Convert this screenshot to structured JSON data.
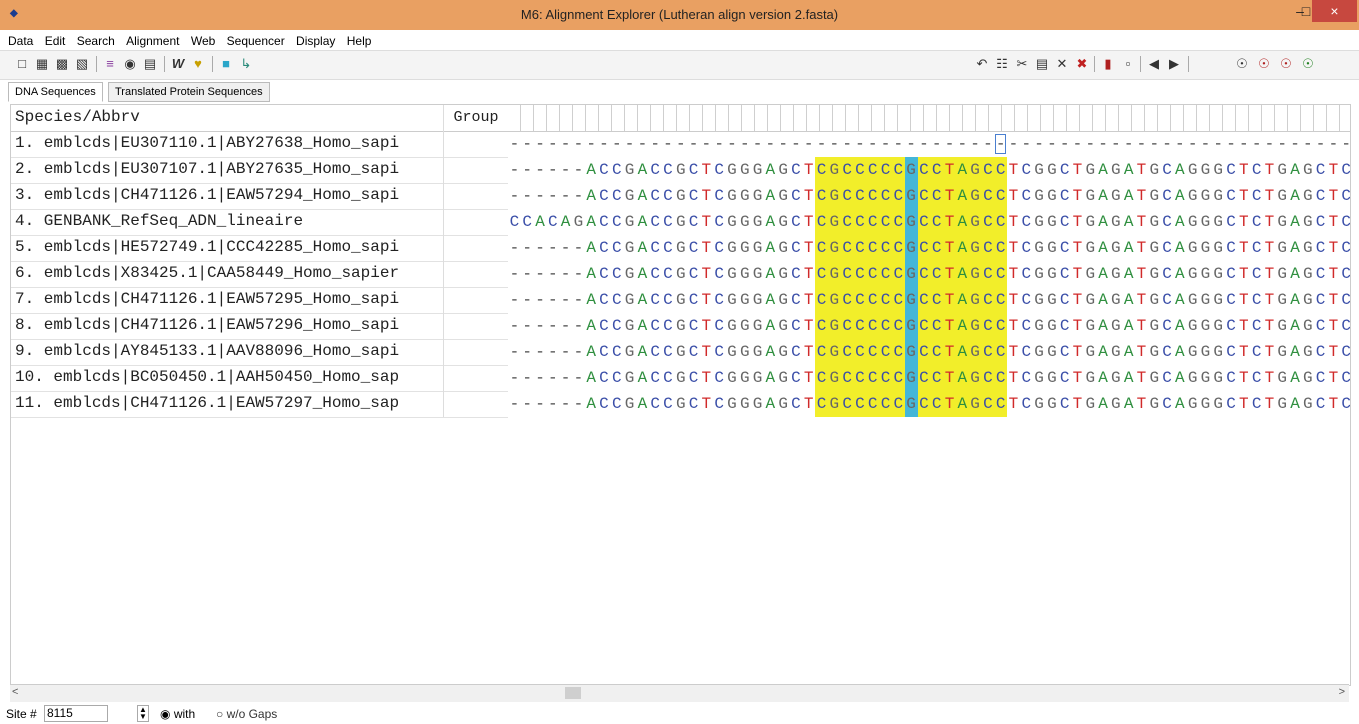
{
  "window": {
    "title": "M6: Alignment Explorer (Lutheran align version 2.fasta)"
  },
  "menu": [
    "Data",
    "Edit",
    "Search",
    "Alignment",
    "Web",
    "Sequencer",
    "Display",
    "Help"
  ],
  "tabs": [
    {
      "label": "DNA Sequences",
      "active": true
    },
    {
      "label": "Translated Protein Sequences",
      "active": false
    }
  ],
  "table": {
    "col_species": "Species/Abbrv",
    "col_group": "Group",
    "rows": [
      "1. emblcds|EU307110.1|ABY27638_Homo_sapi",
      "2. emblcds|EU307107.1|ABY27635_Homo_sapi",
      "3. emblcds|CH471126.1|EAW57294_Homo_sapi",
      "4. GENBANK_RefSeq_ADN_lineaire",
      "5. emblcds|HE572749.1|CCC42285_Homo_sapi",
      "6. emblcds|X83425.1|CAA58449_Homo_sapier",
      "7. emblcds|CH471126.1|EAW57295_Homo_sapi",
      "8. emblcds|CH471126.1|EAW57296_Homo_sapi",
      "9. emblcds|AY845133.1|AAV88096_Homo_sapi",
      "10. emblcds|BC050450.1|AAH50450_Homo_sap",
      "11. emblcds|CH471126.1|EAW57297_Homo_sap"
    ]
  },
  "sequences": [
    "-------------------------------------------------------------------",
    "------ACCGACCGCTCGGGAGCTCGCCCCCGCCTAGCCTCGGCTGAGATGCAGGGCTCTGAGCTC",
    "------ACCGACCGCTCGGGAGCTCGCCCCCGCCTAGCCTCGGCTGAGATGCAGGGCTCTGAGCTC",
    "CCACAGACCGACCGCTCGGGAGCTCGCCCCCGCCTAGCCTCGGCTGAGATGCAGGGCTCTGAGCTC",
    "------ACCGACCGCTCGGGAGCTCGCCCCCGCCTAGCCTCGGCTGAGATGCAGGGCTCTGAGCTC",
    "------ACCGACCGCTCGGGAGCTCGCCCCCGCCTAGCCTCGGCTGAGATGCAGGGCTCTGAGCTC",
    "------ACCGACCGCTCGGGAGCTCGCCCCCGCCTAGCCTCGGCTGAGATGCAGGGCTCTGAGCTC",
    "------ACCGACCGCTCGGGAGCTCGCCCCCGCCTAGCCTCGGCTGAGATGCAGGGCTCTGAGCTC",
    "------ACCGACCGCTCGGGAGCTCGCCCCCGCCTAGCCTCGGCTGAGATGCAGGGCTCTGAGCTC",
    "------ACCGACCGCTCGGGAGCTCGCCCCCGCCTAGCCTCGGCTGAGATGCAGGGCTCTGAGCTC",
    "------ACCGACCGCTCGGGAGCTCGCCCCCGCCTAGCCTCGGCTGAGATGCAGGGCTCTGAGCTC"
  ],
  "highlight": {
    "block_color": "#f2ee2a",
    "column_color": "#44b6d8"
  },
  "base_colors": {
    "A": "#2f8f3f",
    "C": "#3a4ea8",
    "G": "#666666",
    "T": "#d02a2a"
  },
  "status": {
    "site_label": "Site #",
    "site_value": "8115",
    "with_label": "with",
    "without_label": "w/o Gaps"
  }
}
